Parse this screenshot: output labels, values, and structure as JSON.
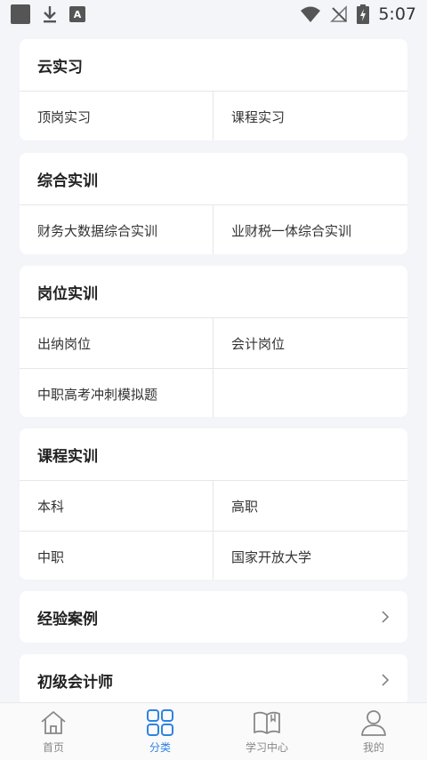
{
  "status_bar": {
    "time": "5:07",
    "app_badge": "A"
  },
  "sections": [
    {
      "title": "云实习",
      "rows": [
        [
          "顶岗实习",
          "课程实习"
        ]
      ]
    },
    {
      "title": "综合实训",
      "rows": [
        [
          "财务大数据综合实训",
          "业财税一体综合实训"
        ]
      ]
    },
    {
      "title": "岗位实训",
      "rows": [
        [
          "出纳岗位",
          "会计岗位"
        ],
        [
          "中职高考冲刺模拟题",
          ""
        ]
      ]
    },
    {
      "title": "课程实训",
      "rows": [
        [
          "本科",
          "高职"
        ],
        [
          "中职",
          "国家开放大学"
        ]
      ]
    }
  ],
  "links": [
    {
      "label": "经验案例"
    },
    {
      "label": "初级会计师"
    }
  ],
  "tabbar": {
    "items": [
      {
        "label": "首页",
        "icon": "home-icon"
      },
      {
        "label": "分类",
        "icon": "grid-icon"
      },
      {
        "label": "学习中心",
        "icon": "book-icon"
      },
      {
        "label": "我的",
        "icon": "user-icon"
      }
    ],
    "active": "分类",
    "active_color": "#2d83e3",
    "inactive_color": "#888888"
  }
}
